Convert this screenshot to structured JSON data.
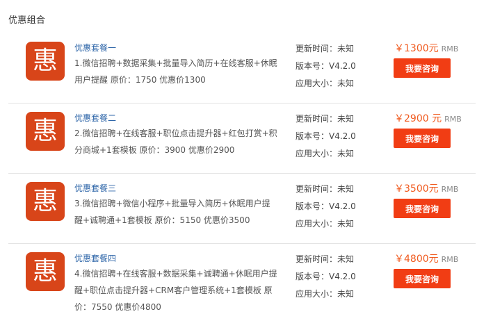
{
  "section_title": "优惠组合",
  "logo_glyph": "惠",
  "packages": [
    {
      "name": "优惠套餐一",
      "description": "1.微信招聘+数据采集+批量导入简历+在线客服+休眠用户提醒 原价：1750 优惠价1300",
      "update_time": "更新时间：未知",
      "version": "版本号：V4.2.0",
      "app_size": "应用大小：未知",
      "price": "￥1300元",
      "currency": "RMB",
      "button": "我要咨询"
    },
    {
      "name": "优惠套餐二",
      "description": "2.微信招聘+在线客服+职位点击提升器+红包打赏+积分商城+1套模板 原价：3900 优惠价2900",
      "update_time": "更新时间：未知",
      "version": "版本号：V4.2.0",
      "app_size": "应用大小：未知",
      "price": "￥2900 元",
      "currency": "RMB",
      "button": "我要咨询"
    },
    {
      "name": "优惠套餐三",
      "description": "3.微信招聘+微信小程序+批量导入简历+休眠用户提醒+诚聘通+1套模板 原价：5150 优惠价3500",
      "update_time": "更新时间：未知",
      "version": "版本号：V4.2.0",
      "app_size": "应用大小：未知",
      "price": "￥3500元",
      "currency": "RMB",
      "button": "我要咨询"
    },
    {
      "name": "优惠套餐四",
      "description": "4.微信招聘+在线客服+数据采集+诚聘通+休眠用户提醒+职位点击提升器+CRM客户管理系统+1套模板 原价：7550 优惠价4800",
      "update_time": "更新时间：未知",
      "version": "版本号：V4.2.0",
      "app_size": "应用大小：未知",
      "price": "￥4800元",
      "currency": "RMB",
      "button": "我要咨询"
    }
  ],
  "colors": {
    "logo_bg": "#d84519",
    "link": "#2d65a8",
    "price": "#f05a1e",
    "button_bg": "#f13d14"
  }
}
